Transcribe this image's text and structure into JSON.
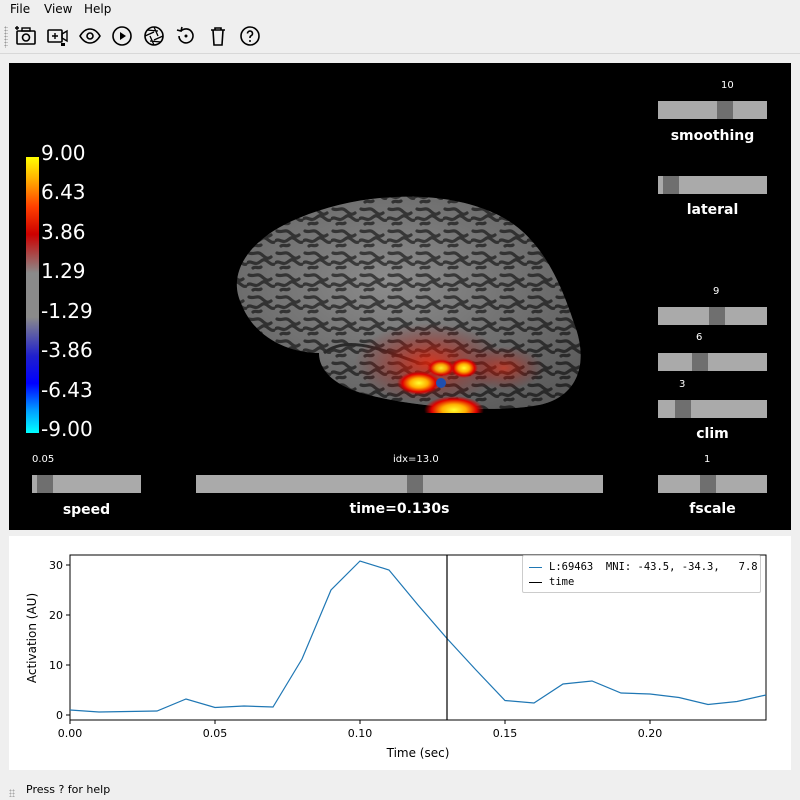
{
  "menu": {
    "file": "File",
    "view": "View",
    "help": "Help"
  },
  "toolbar": {
    "buttons": [
      {
        "name": "screenshot-button",
        "icon": "camera-icon"
      },
      {
        "name": "movie-button",
        "icon": "movie-camera-icon"
      },
      {
        "name": "toggle-interface-button",
        "icon": "eye-icon"
      },
      {
        "name": "play-button",
        "icon": "play-icon"
      },
      {
        "name": "reset-camera-button",
        "icon": "aperture-icon"
      },
      {
        "name": "restore-button",
        "icon": "restore-icon"
      },
      {
        "name": "clear-button",
        "icon": "trash-icon"
      },
      {
        "name": "help-button",
        "icon": "help-icon"
      }
    ]
  },
  "viewer": {
    "colorbar_ticks": [
      "9.00",
      "6.43",
      "3.86",
      "1.29",
      "-1.29",
      "-3.86",
      "-6.43",
      "-9.00"
    ],
    "colorbar_colors": {
      "max": "#ffff00",
      "mid": "#8a8a8a",
      "min": "#00ffff"
    },
    "sliders": {
      "smoothing": {
        "label": "smoothing",
        "value": "10",
        "fraction": 0.63
      },
      "lateral": {
        "label": "lateral",
        "fraction": 0.05
      },
      "clim_high": {
        "value": "9",
        "fraction": 0.55
      },
      "clim_mid": {
        "value": "6",
        "fraction": 0.37
      },
      "clim_low": {
        "value": "3",
        "fraction": 0.18
      },
      "clim_label": "clim",
      "speed": {
        "label": "speed",
        "value": "0.05",
        "fraction": 0.05
      },
      "time": {
        "label": "time=0.130s",
        "value": "idx=13.0",
        "fraction": 0.54
      },
      "fscale": {
        "label": "fscale",
        "value": "1",
        "fraction": 0.45
      }
    }
  },
  "legend": {
    "series_label": "L:69463  MNI: -43.5, -34.3,   7.8",
    "time_label": "time",
    "series_color": "#1f77b4",
    "time_color": "#000000"
  },
  "chart_data": {
    "type": "line",
    "xlabel": "Time (sec)",
    "ylabel": "Activation (AU)",
    "xlim": [
      0.0,
      0.24
    ],
    "ylim": [
      -1,
      32
    ],
    "xticks": [
      "0.00",
      "0.05",
      "0.10",
      "0.15",
      "0.20"
    ],
    "xtick_values": [
      0.0,
      0.05,
      0.1,
      0.15,
      0.2
    ],
    "yticks": [
      "0",
      "10",
      "20",
      "30"
    ],
    "ytick_values": [
      0,
      10,
      20,
      30
    ],
    "series": [
      {
        "name": "L:69463  MNI: -43.5, -34.3,   7.8",
        "x": [
          0.0,
          0.01,
          0.02,
          0.03,
          0.04,
          0.05,
          0.06,
          0.07,
          0.08,
          0.09,
          0.1,
          0.11,
          0.12,
          0.13,
          0.14,
          0.15,
          0.16,
          0.17,
          0.18,
          0.19,
          0.2,
          0.21,
          0.22,
          0.23,
          0.24
        ],
        "y": [
          1.0,
          0.6,
          0.7,
          0.8,
          3.2,
          1.5,
          1.8,
          1.6,
          11.2,
          25.0,
          30.8,
          29.0,
          22.0,
          15.3,
          9.0,
          2.9,
          2.4,
          6.2,
          6.8,
          4.4,
          4.2,
          3.5,
          2.1,
          2.7,
          4.0
        ]
      }
    ],
    "vline": {
      "name": "time",
      "x": 0.13
    },
    "grid": false,
    "legend_position": "top-right"
  },
  "status": {
    "text": "Press ? for help"
  }
}
